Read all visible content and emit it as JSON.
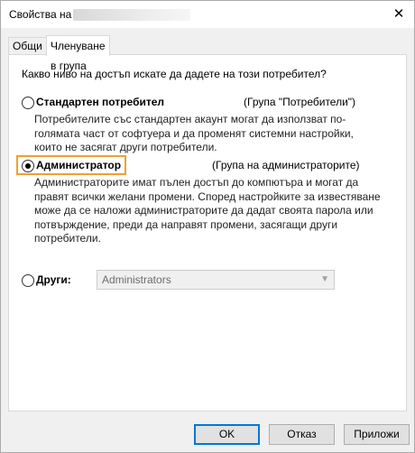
{
  "window": {
    "title": "Свойства на",
    "close_glyph": "✕"
  },
  "tabs": [
    {
      "label": "Общи",
      "active": false
    },
    {
      "label": "Членуване в група",
      "active": true
    }
  ],
  "panel": {
    "question": "Какво ниво на достъп искате да дадете на този потребител?",
    "options": [
      {
        "label": "Стандартен потребител",
        "group": "(Група \"Потребители\")",
        "selected": false,
        "description": "Потребителите със стандартен акаунт могат да използват по-голямата част от софтуера и да променят системни настройки, които не засягат други потребители."
      },
      {
        "label": "Администратор",
        "group": "(Група на администраторите)",
        "selected": true,
        "description": "Администраторите имат пълен достъп до компютъра и могат да правят всички желани промени. Според настройките за известяване може да се наложи администраторите да дадат своята парола или потвърждение, преди да направят промени, засягащи други потребители."
      },
      {
        "label": "Други:",
        "selected": false,
        "select_value": "Administrators"
      }
    ]
  },
  "buttons": {
    "ok": "OK",
    "cancel": "Отказ",
    "apply": "Приложи"
  },
  "colors": {
    "highlight": "#f0a030",
    "default_button_border": "#0078d7"
  }
}
